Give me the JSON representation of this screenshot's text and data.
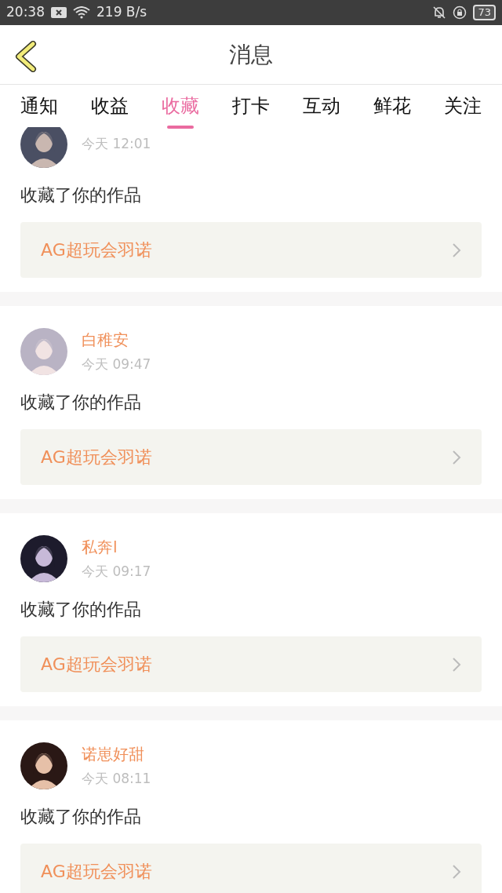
{
  "status_bar": {
    "time": "20:38",
    "speed": "219 B/s",
    "battery": "73"
  },
  "header": {
    "title": "消息"
  },
  "tabs": [
    {
      "label": "通知",
      "selected": false
    },
    {
      "label": "收益",
      "selected": false
    },
    {
      "label": "收藏",
      "selected": true
    },
    {
      "label": "打卡",
      "selected": false
    },
    {
      "label": "互动",
      "selected": false
    },
    {
      "label": "鲜花",
      "selected": false
    },
    {
      "label": "关注",
      "selected": false
    }
  ],
  "messages": [
    {
      "time": "今天 12:01",
      "text": "收藏了你的作品",
      "work": "AG超玩会羽诺"
    },
    {
      "name": "白稚安",
      "time": "今天 09:47",
      "text": "收藏了你的作品",
      "work": "AG超玩会羽诺"
    },
    {
      "name": "私奔l",
      "time": "今天 09:17",
      "text": "收藏了你的作品",
      "work": "AG超玩会羽诺"
    },
    {
      "name": "诺崽好甜",
      "time": "今天 08:11",
      "text": "收藏了你的作品",
      "work": "AG超玩会羽诺"
    }
  ]
}
